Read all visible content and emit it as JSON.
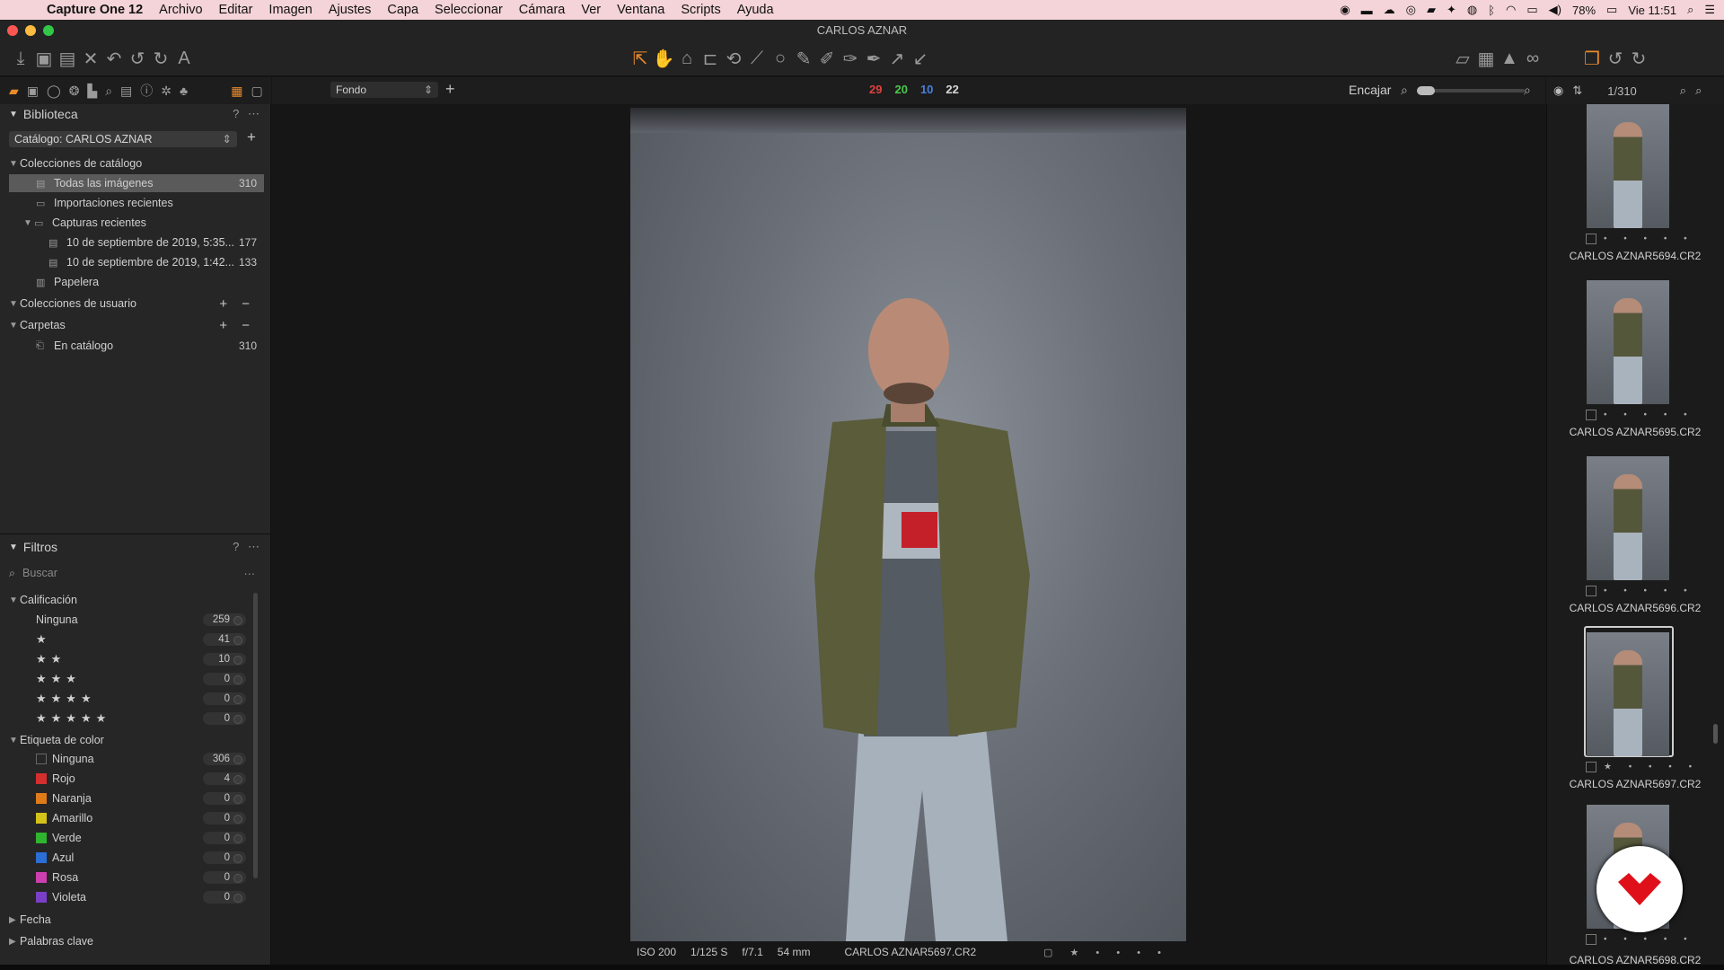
{
  "menubar": {
    "app": "Capture One 12",
    "items": [
      "Archivo",
      "Editar",
      "Imagen",
      "Ajustes",
      "Capa",
      "Seleccionar",
      "Cámara",
      "Ver",
      "Ventana",
      "Scripts",
      "Ayuda"
    ],
    "battery": "78%",
    "clock": "Vie 11:51"
  },
  "window": {
    "title": "CARLOS AZNAR"
  },
  "library": {
    "title": "Biblioteca",
    "help": "?",
    "catalog": "Catálogo: CARLOS AZNAR",
    "catalog_collections": "Colecciones de catálogo",
    "all_images": {
      "label": "Todas las imágenes",
      "count": "310"
    },
    "recent_imports": "Importaciones recientes",
    "recent_captures": "Capturas recientes",
    "capture1": {
      "label": "10 de septiembre de 2019, 5:35...",
      "count": "177"
    },
    "capture2": {
      "label": "10 de septiembre de 2019, 1:42...",
      "count": "133"
    },
    "trash": "Papelera",
    "user_collections": "Colecciones de usuario",
    "folders": "Carpetas",
    "in_catalog": {
      "label": "En catálogo",
      "count": "310"
    }
  },
  "filters": {
    "title": "Filtros",
    "help": "?",
    "search_placeholder": "Buscar",
    "rating_title": "Calificación",
    "ratings": [
      {
        "label": "Ninguna",
        "count": "259"
      },
      {
        "label": "★",
        "count": "41"
      },
      {
        "label": "★★",
        "count": "10"
      },
      {
        "label": "★★★",
        "count": "0"
      },
      {
        "label": "★★★★",
        "count": "0"
      },
      {
        "label": "★★★★★",
        "count": "0"
      }
    ],
    "color_title": "Etiqueta de color",
    "colors": [
      {
        "label": "Ninguna",
        "count": "306",
        "color": "transparent"
      },
      {
        "label": "Rojo",
        "count": "4",
        "color": "#d32f2f"
      },
      {
        "label": "Naranja",
        "count": "0",
        "color": "#e07b1a"
      },
      {
        "label": "Amarillo",
        "count": "0",
        "color": "#d4c21a"
      },
      {
        "label": "Verde",
        "count": "0",
        "color": "#2fb42f"
      },
      {
        "label": "Azul",
        "count": "0",
        "color": "#2a6ed6"
      },
      {
        "label": "Rosa",
        "count": "0",
        "color": "#cc3fb0"
      },
      {
        "label": "Violeta",
        "count": "0",
        "color": "#7a3fc9"
      }
    ],
    "date": "Fecha",
    "keywords": "Palabras clave"
  },
  "viewer": {
    "background_select": "Fondo",
    "counts": [
      {
        "value": "29",
        "color": "#e0413f"
      },
      {
        "value": "20",
        "color": "#4cc94c"
      },
      {
        "value": "10",
        "color": "#4a7fe0"
      },
      {
        "value": "22",
        "color": "#d8d8d8"
      }
    ],
    "zoom_label": "Encajar"
  },
  "info": {
    "iso": "ISO 200",
    "shutter": "1/125 S",
    "aperture": "f/7.1",
    "focal": "54 mm",
    "filename": "CARLOS AZNAR5697.CR2"
  },
  "browser": {
    "position": "1/310",
    "thumbs": [
      {
        "label": "CARLOS AZNAR5694.CR2",
        "stars": "• • • • •"
      },
      {
        "label": "CARLOS AZNAR5695.CR2",
        "stars": "• • • • •"
      },
      {
        "label": "CARLOS AZNAR5696.CR2",
        "stars": "• • • • •"
      },
      {
        "label": "CARLOS AZNAR5697.CR2",
        "stars": "★ • • • •"
      },
      {
        "label": "CARLOS AZNAR5698.CR2",
        "stars": "• • • • •"
      }
    ]
  },
  "colors": {
    "accent": "#e88a2a",
    "panel": "#262626",
    "viewer_bg": "#161616",
    "brand_logo": "#e0101a"
  }
}
